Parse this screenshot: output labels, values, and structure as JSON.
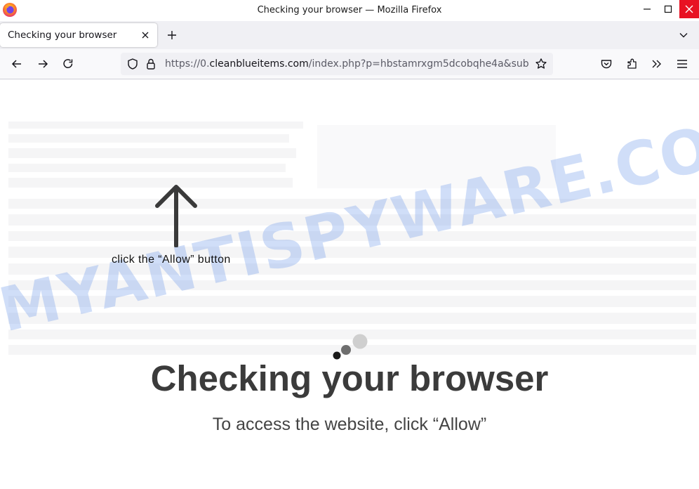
{
  "window": {
    "title": "Checking your browser — Mozilla Firefox",
    "app_icon": "firefox-logo",
    "close_color": "#e81123"
  },
  "tabs": [
    {
      "title": "Checking your browser",
      "active": true
    }
  ],
  "toolbar": {
    "back_icon": "back-arrow-icon",
    "forward_icon": "forward-arrow-icon",
    "reload_icon": "reload-icon",
    "pocket_icon": "pocket-icon",
    "extensions_icon": "extensions-icon",
    "overflow_icon": "chevron-double-right-icon",
    "menu_icon": "hamburger-menu-icon"
  },
  "urlbar": {
    "prefix": "https://0.",
    "host": "cleanblueitems.com",
    "path": "/index.php?p=hbstamrxgm5dcobqhe4a&sub",
    "shield_icon": "tracking-protection-icon",
    "lock_icon": "lock-icon",
    "bookmark_icon": "bookmark-star-icon"
  },
  "page": {
    "arrow_label": "click the “Allow” button",
    "heading": "Checking your browser",
    "subheading": "To access the website, click “Allow”"
  },
  "watermark": {
    "text": "MYANTISPYWARE.COM",
    "color": "#78a0eb"
  }
}
